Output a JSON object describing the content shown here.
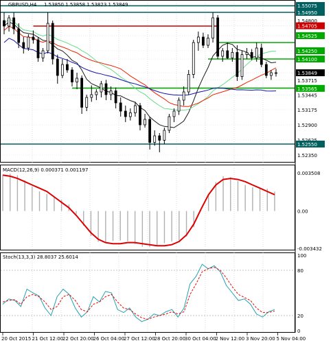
{
  "header": {
    "symbol": "GBPUSD,H4",
    "ohlc": "1.53850 1.53858 1.53823 1.53849"
  },
  "main_panel": {
    "price_axis_labels": [
      "1.55075",
      "1.54950",
      "1.54800",
      "1.54705",
      "1.54525",
      "1.54250",
      "1.54100",
      "1.53849",
      "1.53715",
      "1.53565",
      "1.53445",
      "1.53175",
      "1.52900",
      "1.52625",
      "1.52550",
      "1.52350"
    ],
    "current_price": "1.53849"
  },
  "macd_panel": {
    "header": "MACD(12,26,9) 0.000371 0.001197",
    "axis_labels": [
      "0.003508",
      "0.00",
      "-0.003432"
    ]
  },
  "stoch_panel": {
    "header": "Stoch(13,3,3) 28.8037 25.6014",
    "axis_labels": [
      "100",
      "80",
      "20",
      "0"
    ]
  },
  "time_axis": {
    "labels": [
      "20 Oct 2015",
      "21 Oct 12:00",
      "22 Oct 20:00",
      "26 Oct 04:00",
      "27 Oct 12:00",
      "28 Oct 20:00",
      "30 Oct 04:00",
      "2 Nov 12:00",
      "3 Nov 20:00",
      "5 Nov 04:00"
    ]
  },
  "colors": {
    "candle": "#000000",
    "resistance_line": "#cc0000",
    "support_line": "#00aa00",
    "top_line": "#006060",
    "ma_black": "#1a1a1a",
    "ma_red": "#ee2200",
    "ma_blue": "#1010aa",
    "ma_green": "#66dd88",
    "macd_signal": "#dd0000",
    "macd_hist": "#b0b0b0",
    "stoch_main": "#20a0b0",
    "stoch_signal": "#ee0000"
  },
  "chart_data": {
    "type": "candlestick",
    "symbol": "GBPUSD",
    "timeframe": "H4",
    "ylim": [
      1.5225,
      1.5515
    ],
    "ohlc": [
      [
        1.548,
        1.5495,
        1.5455,
        1.547
      ],
      [
        1.547,
        1.549,
        1.546,
        1.5485
      ],
      [
        1.5485,
        1.5495,
        1.5455,
        1.5465
      ],
      [
        1.5465,
        1.5475,
        1.543,
        1.544
      ],
      [
        1.544,
        1.545,
        1.542,
        1.543
      ],
      [
        1.543,
        1.5455,
        1.5425,
        1.545
      ],
      [
        1.545,
        1.5462,
        1.5438,
        1.5445
      ],
      [
        1.5445,
        1.545,
        1.5405,
        1.5412
      ],
      [
        1.5412,
        1.543,
        1.5405,
        1.5425
      ],
      [
        1.5425,
        1.5495,
        1.542,
        1.5475
      ],
      [
        1.5475,
        1.548,
        1.54,
        1.541
      ],
      [
        1.541,
        1.5418,
        1.5365,
        1.538
      ],
      [
        1.538,
        1.541,
        1.5375,
        1.54
      ],
      [
        1.54,
        1.541,
        1.5385,
        1.539
      ],
      [
        1.539,
        1.5395,
        1.536,
        1.5368
      ],
      [
        1.5368,
        1.5385,
        1.5355,
        1.5375
      ],
      [
        1.5375,
        1.538,
        1.531,
        1.5322
      ],
      [
        1.5322,
        1.5345,
        1.5315,
        1.534
      ],
      [
        1.534,
        1.5362,
        1.5332,
        1.5345
      ],
      [
        1.5345,
        1.5355,
        1.5335,
        1.535
      ],
      [
        1.535,
        1.537,
        1.534,
        1.5365
      ],
      [
        1.5365,
        1.5372,
        1.5335,
        1.5345
      ],
      [
        1.5345,
        1.536,
        1.5335,
        1.5352
      ],
      [
        1.5352,
        1.5358,
        1.532,
        1.533
      ],
      [
        1.533,
        1.534,
        1.5305,
        1.5315
      ],
      [
        1.5315,
        1.5325,
        1.5295,
        1.5305
      ],
      [
        1.5305,
        1.532,
        1.5298,
        1.5312
      ],
      [
        1.5312,
        1.5332,
        1.5305,
        1.5325
      ],
      [
        1.5325,
        1.533,
        1.528,
        1.529
      ],
      [
        1.529,
        1.531,
        1.5285,
        1.53
      ],
      [
        1.53,
        1.5305,
        1.5245,
        1.5258
      ],
      [
        1.5258,
        1.528,
        1.5252,
        1.527
      ],
      [
        1.527,
        1.5275,
        1.524,
        1.5262
      ],
      [
        1.5262,
        1.5285,
        1.5255,
        1.528
      ],
      [
        1.528,
        1.531,
        1.5275,
        1.5305
      ],
      [
        1.5305,
        1.532,
        1.5295,
        1.5315
      ],
      [
        1.5315,
        1.534,
        1.5308,
        1.5335
      ],
      [
        1.5335,
        1.536,
        1.5325,
        1.535
      ],
      [
        1.535,
        1.539,
        1.5345,
        1.5382
      ],
      [
        1.5382,
        1.5445,
        1.5375,
        1.544
      ],
      [
        1.544,
        1.546,
        1.5425,
        1.545
      ],
      [
        1.545,
        1.5458,
        1.543,
        1.5435
      ],
      [
        1.5435,
        1.5455,
        1.543,
        1.5448
      ],
      [
        1.5448,
        1.5495,
        1.544,
        1.5485
      ],
      [
        1.5485,
        1.549,
        1.541,
        1.5415
      ],
      [
        1.5415,
        1.543,
        1.5405,
        1.5425
      ],
      [
        1.5425,
        1.544,
        1.541,
        1.5412
      ],
      [
        1.5412,
        1.543,
        1.5405,
        1.5422
      ],
      [
        1.5422,
        1.5435,
        1.537,
        1.5378
      ],
      [
        1.5378,
        1.5425,
        1.5372,
        1.5418
      ],
      [
        1.5418,
        1.543,
        1.541,
        1.5422
      ],
      [
        1.5422,
        1.5428,
        1.5408,
        1.5412
      ],
      [
        1.5412,
        1.544,
        1.5405,
        1.543
      ],
      [
        1.543,
        1.5438,
        1.5395,
        1.54
      ],
      [
        1.54,
        1.5405,
        1.5375,
        1.538
      ],
      [
        1.538,
        1.539,
        1.5372,
        1.5385
      ],
      [
        1.5385,
        1.5392,
        1.5378,
        1.5385
      ]
    ],
    "horizontal_levels": [
      {
        "price": 1.5507,
        "color": "#006060",
        "style": "solid"
      },
      {
        "price": 1.5495,
        "color": "#006060",
        "style": "solid"
      },
      {
        "price": 1.547,
        "color": "#cc0000",
        "style": "solid"
      },
      {
        "price": 1.544,
        "color": "#00aa00",
        "style": "solid"
      },
      {
        "price": 1.541,
        "color": "#00aa00",
        "style": "solid"
      },
      {
        "price": 1.5357,
        "color": "#00aa00",
        "style": "solid"
      },
      {
        "price": 1.5255,
        "color": "#006060",
        "style": "solid"
      }
    ],
    "macd": {
      "axis_range": [
        -0.003432,
        0.003508
      ],
      "signal": [
        0.0033,
        0.0032,
        0.003,
        0.0027,
        0.0024,
        0.0021,
        0.0018,
        0.0013,
        0.0008,
        0.0003,
        -0.0004,
        -0.0012,
        -0.002,
        -0.0026,
        -0.0029,
        -0.003,
        -0.003,
        -0.0029,
        -0.0029,
        -0.003,
        -0.0031,
        -0.0032,
        -0.0032,
        -0.0031,
        -0.0028,
        -0.0022,
        -0.0012,
        0.0002,
        0.0015,
        0.0024,
        0.0029,
        0.003,
        0.0029,
        0.0027,
        0.0024,
        0.0021,
        0.0018,
        0.0015
      ]
    },
    "stoch": {
      "axis_range": [
        0,
        100
      ],
      "main": [
        35,
        42,
        40,
        32,
        55,
        50,
        46,
        30,
        20,
        45,
        55,
        48,
        30,
        18,
        25,
        45,
        38,
        52,
        50,
        28,
        24,
        30,
        18,
        12,
        15,
        22,
        20,
        25,
        28,
        18,
        30,
        62,
        72,
        88,
        82,
        86,
        78,
        60,
        50,
        40,
        42,
        35,
        22,
        18,
        25,
        28
      ],
      "signal": [
        38,
        40,
        41,
        35,
        45,
        48,
        45,
        38,
        28,
        32,
        45,
        48,
        40,
        28,
        25,
        35,
        38,
        45,
        48,
        38,
        30,
        28,
        22,
        17,
        15,
        18,
        20,
        22,
        25,
        22,
        25,
        48,
        62,
        78,
        82,
        84,
        80,
        70,
        58,
        48,
        44,
        40,
        30,
        24,
        24,
        26
      ]
    }
  }
}
